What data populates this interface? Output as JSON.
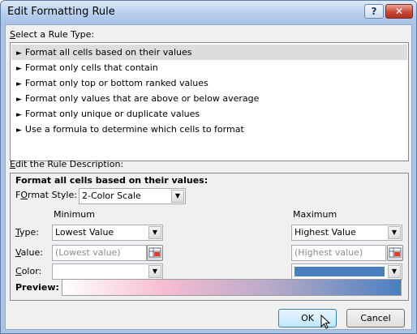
{
  "window": {
    "title": "Edit Formatting Rule",
    "help_label": "?",
    "close_label": "✕"
  },
  "rule_type": {
    "label_underline": "S",
    "label_rest": "elect a Rule Type:",
    "items": [
      {
        "label": "Format all cells based on their values",
        "selected": true
      },
      {
        "label": "Format only cells that contain",
        "selected": false
      },
      {
        "label": "Format only top or bottom ranked values",
        "selected": false
      },
      {
        "label": "Format only values that are above or below average",
        "selected": false
      },
      {
        "label": "Format only unique or duplicate values",
        "selected": false
      },
      {
        "label": "Use a formula to determine which cells to format",
        "selected": false
      }
    ]
  },
  "description": {
    "label_underline": "E",
    "label_rest": "dit the Rule Description:",
    "heading": "Format all cells based on their values:",
    "format_style_underline": "O",
    "format_style_label": "Format Style:",
    "format_style_pre": "F",
    "format_style_post": "rmat Style:",
    "format_style_value": "2-Color Scale",
    "minimum_header": "Minimum",
    "maximum_header": "Maximum",
    "type_label_u": "T",
    "type_label_rest": "ype:",
    "value_label_u": "V",
    "value_label_rest": "alue:",
    "color_label_u": "C",
    "color_label_rest": "olor:",
    "min_type": "Lowest Value",
    "max_type": "Highest Value",
    "min_value_placeholder": "(Lowest value)",
    "max_value_placeholder": "(Highest value)",
    "min_color": "#ffffff",
    "max_color": "#4a7fc0",
    "preview_label": "Preview:"
  },
  "buttons": {
    "ok": "OK",
    "cancel": "Cancel"
  }
}
